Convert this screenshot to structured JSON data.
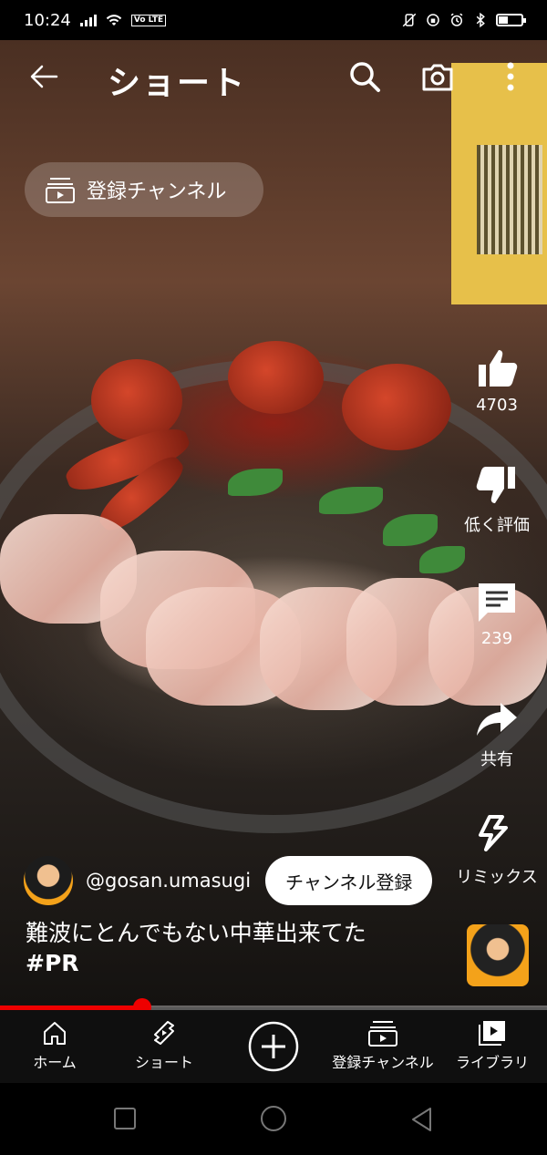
{
  "status_bar": {
    "time": "10:24",
    "network_badge": "Vo LTE",
    "battery_level": 0.45,
    "icons": [
      "signal-icon",
      "wifi-icon",
      "vibrate-off-icon",
      "data-saver-icon",
      "alarm-icon",
      "bluetooth-icon",
      "battery-icon"
    ]
  },
  "appbar": {
    "title": "ショート",
    "icons": [
      "back-arrow-icon",
      "search-icon",
      "camera-icon",
      "more-vert-icon"
    ]
  },
  "subscriptions_chip": {
    "label": "登録チャンネル",
    "icon": "subscriptions-icon"
  },
  "actions": {
    "like": {
      "label": "4703",
      "icon": "thumb-up-icon"
    },
    "dislike": {
      "label": "低く評価",
      "icon": "thumb-down-icon"
    },
    "comments": {
      "label": "239",
      "icon": "comment-icon"
    },
    "share": {
      "label": "共有",
      "icon": "share-icon"
    },
    "remix": {
      "label": "リミックス",
      "icon": "remix-icon"
    }
  },
  "channel": {
    "handle": "@gosan.umasugi",
    "subscribe_label": "チャンネル登録"
  },
  "caption": {
    "title": "難波にとんでもない中華出来てた",
    "hashtag": "#PR"
  },
  "progress": {
    "played_fraction": 0.26
  },
  "bottom_nav": {
    "items": [
      {
        "label": "ホーム",
        "icon": "home-icon"
      },
      {
        "label": "ショート",
        "icon": "shorts-icon"
      },
      {
        "label": "",
        "icon": "create-plus-icon"
      },
      {
        "label": "登録チャンネル",
        "icon": "subscriptions-icon"
      },
      {
        "label": "ライブラリ",
        "icon": "library-icon"
      }
    ]
  },
  "system_nav": {
    "icons": [
      "recents-icon",
      "home-circle-icon",
      "back-triangle-icon"
    ]
  },
  "colors": {
    "accent": "#ff0000",
    "nav_bg": "#0f0f0f",
    "chip_bg": "rgba(255,255,255,0.2)"
  }
}
